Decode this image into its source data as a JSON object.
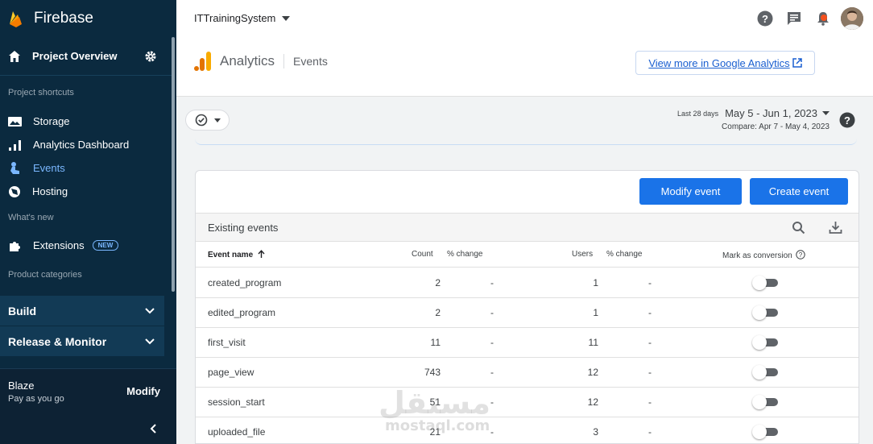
{
  "sidebar": {
    "brand": "Firebase",
    "project_overview": "Project Overview",
    "sections": {
      "shortcuts": "Project shortcuts",
      "whats_new": "What's new",
      "categories": "Product categories"
    },
    "shortcuts": [
      {
        "label": "Storage",
        "icon": "image-icon"
      },
      {
        "label": "Analytics Dashboard",
        "icon": "bar-chart-icon"
      },
      {
        "label": "Events",
        "icon": "touch-icon",
        "active": true
      },
      {
        "label": "Hosting",
        "icon": "globe-icon"
      }
    ],
    "extensions": {
      "label": "Extensions",
      "badge": "NEW"
    },
    "categories": [
      {
        "label": "Build"
      },
      {
        "label": "Release & Monitor"
      }
    ],
    "plan": {
      "name": "Blaze",
      "desc": "Pay as you go",
      "action": "Modify"
    }
  },
  "header": {
    "project": "ITTrainingSystem",
    "title": "Analytics",
    "subtitle": "Events",
    "ga_link": "View more in Google Analytics"
  },
  "date_range": {
    "period_label": "Last 28 days",
    "range": "May 5 - Jun 1, 2023",
    "compare": "Compare: Apr 7 - May 4, 2023"
  },
  "card": {
    "modify_button": "Modify event",
    "create_button": "Create event",
    "section_title": "Existing events",
    "columns": {
      "event_name": "Event name",
      "count": "Count",
      "count_change": "% change",
      "users": "Users",
      "users_change": "% change",
      "conversion": "Mark as conversion"
    },
    "rows": [
      {
        "name": "created_program",
        "count": "2",
        "count_change": "-",
        "users": "1",
        "users_change": "-",
        "conversion": false
      },
      {
        "name": "edited_program",
        "count": "2",
        "count_change": "-",
        "users": "1",
        "users_change": "-",
        "conversion": false
      },
      {
        "name": "first_visit",
        "count": "11",
        "count_change": "-",
        "users": "11",
        "users_change": "-",
        "conversion": false
      },
      {
        "name": "page_view",
        "count": "743",
        "count_change": "-",
        "users": "12",
        "users_change": "-",
        "conversion": false
      },
      {
        "name": "session_start",
        "count": "51",
        "count_change": "-",
        "users": "12",
        "users_change": "-",
        "conversion": false
      },
      {
        "name": "uploaded_file",
        "count": "21",
        "count_change": "-",
        "users": "3",
        "users_change": "-",
        "conversion": false
      }
    ]
  },
  "watermark": {
    "arabic": "مستقل",
    "latin": "mostaql.com"
  },
  "colors": {
    "sidebar": "#0b2a3f",
    "primary": "#1a73e8",
    "active": "#7ab7ff"
  }
}
